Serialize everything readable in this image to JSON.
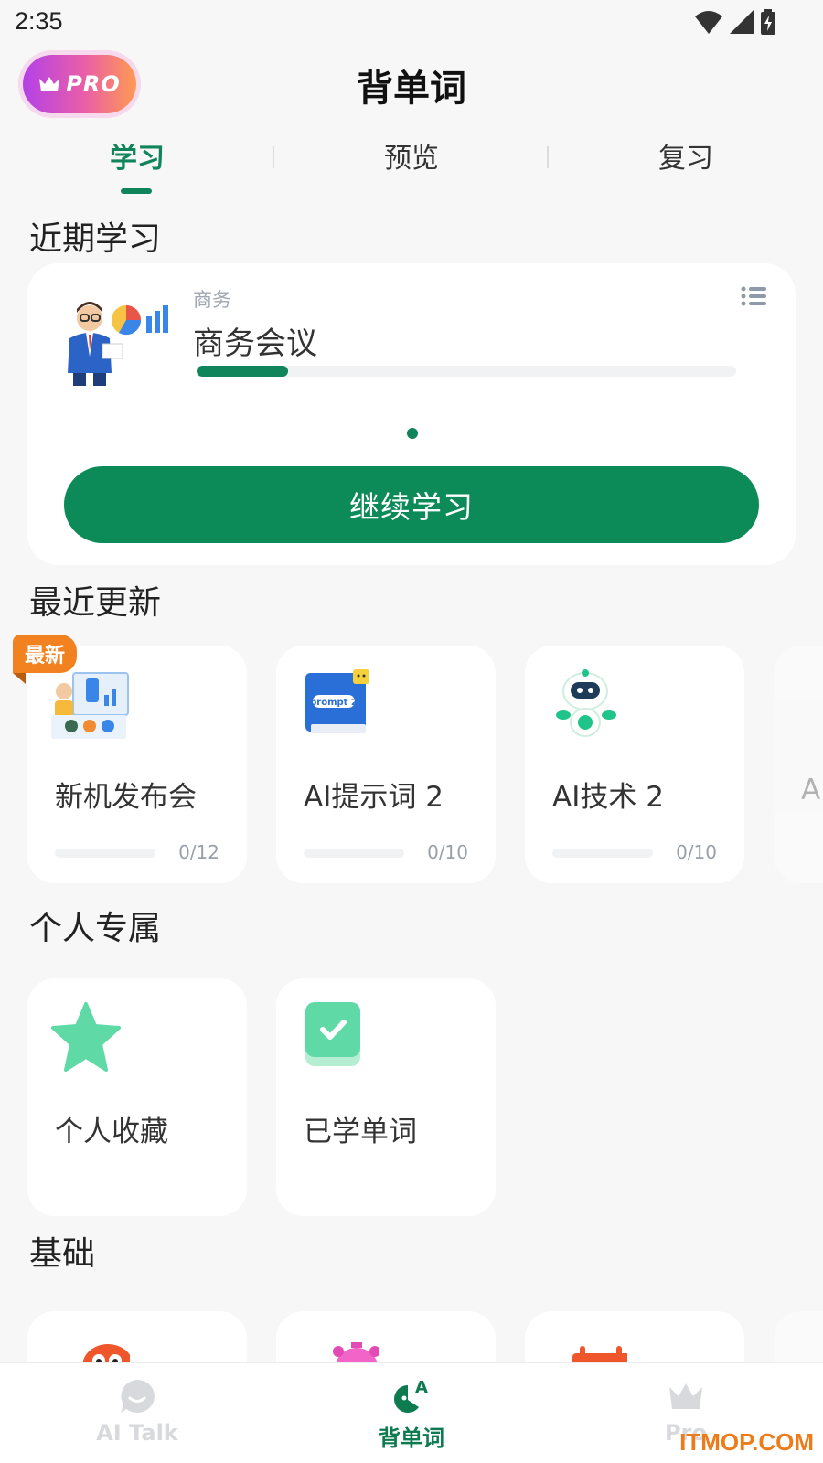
{
  "status_bar": {
    "time": "2:35"
  },
  "header": {
    "pro_label": "PRO",
    "title": "背单词"
  },
  "tabs": [
    {
      "label": "学习",
      "active": true
    },
    {
      "label": "预览",
      "active": false
    },
    {
      "label": "复习",
      "active": false
    }
  ],
  "recent_study": {
    "section_title": "近期学习",
    "category": "商务",
    "name": "商务会议",
    "progress": 0.17,
    "continue_label": "继续学习"
  },
  "recent_updates": {
    "section_title": "最近更新",
    "new_badge": "最新",
    "items": [
      {
        "name": "新机发布会",
        "count": "0/12",
        "progress": 0,
        "icon": "product-launch-icon"
      },
      {
        "name": "AI提示词 2",
        "count": "0/10",
        "progress": 0,
        "icon": "prompt-book-icon"
      },
      {
        "name": "AI技术 2",
        "count": "0/10",
        "progress": 0,
        "icon": "robot-icon"
      },
      {
        "name": "A",
        "count": "",
        "progress": 0,
        "icon": "partial-card-icon"
      }
    ]
  },
  "personal": {
    "section_title": "个人专属",
    "items": [
      {
        "name": "个人收藏",
        "icon": "star-icon"
      },
      {
        "name": "已学单词",
        "icon": "check-icon"
      }
    ]
  },
  "basics": {
    "section_title": "基础"
  },
  "bottom_nav": [
    {
      "label": "AI Talk",
      "icon": "chat-bubble-icon",
      "active": false
    },
    {
      "label": "背单词",
      "icon": "vocab-icon",
      "active": true
    },
    {
      "label": "Pro",
      "icon": "crown-icon",
      "active": false
    }
  ],
  "watermark": "ITMOP.COM",
  "colors": {
    "accent": "#0c8a57",
    "new_badge": "#f2821f",
    "background": "#f7f7f8"
  }
}
